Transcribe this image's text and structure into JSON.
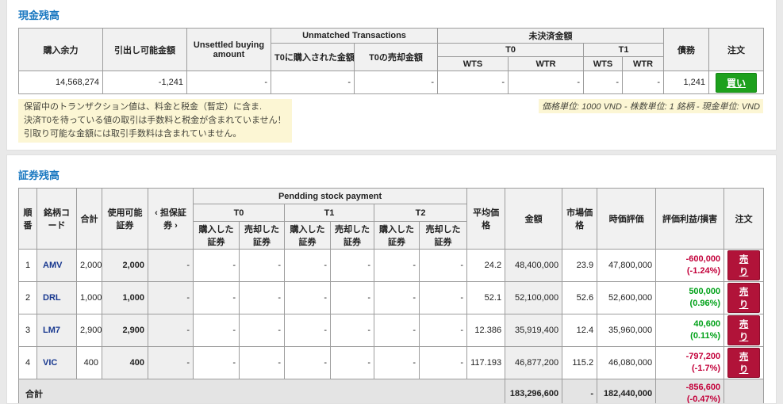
{
  "colors": {
    "title_blue": "#1877c0",
    "buy_green": "#1da01d",
    "sell_crimson": "#b11339",
    "gain_green": "#00a118",
    "loss_red": "#c3003a",
    "note_bg": "#fcf6d4"
  },
  "cash": {
    "title": "現金残高",
    "headers": {
      "buying_power": "購入余力",
      "withdrawable": "引出し可能金額",
      "unsettled_buying": "Unsettled buying amount",
      "unmatched": "Unmatched Transactions",
      "t0_bought": "T0に購入された金額",
      "t0_sold": "T0の売却金額",
      "pending_amount": "未決済金額",
      "t0": "T0",
      "t1": "T1",
      "t0_wts": "WTS",
      "t0_wtr": "WTR",
      "t1_wts": "WTS",
      "t1_wtr": "WTR",
      "debt": "債務",
      "order": "注文"
    },
    "row": {
      "buying_power": "14,568,274",
      "withdrawable": "-1,241",
      "unsettled_buying": "-",
      "t0_bought": "-",
      "t0_sold": "-",
      "t0_wts": "-",
      "t0_wtr": "-",
      "t1_wts": "-",
      "t1_wtr": "-",
      "debt": "1,241"
    },
    "buy_button": "買い",
    "notes": [
      "保留中のトランザクション値は、料金と税金（暫定）に含ま.",
      "決済T0を待っている値の取引は手数料と税金が含まれていません！",
      "引取り可能な金額には取引手数料は含まれていません。"
    ],
    "unit_note": "価格単位: 1000 VND - 株数単位: 1 銘柄 - 現金単位: VND"
  },
  "stock": {
    "title": "証券残高",
    "headers": {
      "index": "順番",
      "code": "銘柄コード",
      "total": "合計",
      "available": "使用可能証券",
      "collateral": "‹ 担保証券 ›",
      "pending": "Pendding stock payment",
      "t0": "T0",
      "t1": "T1",
      "t2": "T2",
      "t0_bought": "購入した証券",
      "t0_sold": "売却した証券",
      "t1_bought": "購入した証券",
      "t1_sold": "売却した証券",
      "t2_bought": "購入した証券",
      "t2_sold": "売却した証券",
      "avg_price": "平均価格",
      "amount": "金額",
      "market_price": "市場価格",
      "market_value": "時価評価",
      "profit_loss": "評価利益/損害",
      "order": "注文"
    },
    "sell_button": "売り",
    "rows": [
      {
        "index": "1",
        "code": "AMV",
        "total": "2,000",
        "available": "2,000",
        "collateral": "-",
        "t0b": "-",
        "t0s": "-",
        "t1b": "-",
        "t1s": "-",
        "t2b": "-",
        "t2s": "-",
        "avg": "24.2",
        "amount": "48,400,000",
        "market": "23.9",
        "value": "47,800,000",
        "profit": "-600,000",
        "pct": "(-1.24%)",
        "trend": "loss"
      },
      {
        "index": "2",
        "code": "DRL",
        "total": "1,000",
        "available": "1,000",
        "collateral": "-",
        "t0b": "-",
        "t0s": "-",
        "t1b": "-",
        "t1s": "-",
        "t2b": "-",
        "t2s": "-",
        "avg": "52.1",
        "amount": "52,100,000",
        "market": "52.6",
        "value": "52,600,000",
        "profit": "500,000",
        "pct": "(0.96%)",
        "trend": "gain"
      },
      {
        "index": "3",
        "code": "LM7",
        "total": "2,900",
        "available": "2,900",
        "collateral": "-",
        "t0b": "-",
        "t0s": "-",
        "t1b": "-",
        "t1s": "-",
        "t2b": "-",
        "t2s": "-",
        "avg": "12.386",
        "amount": "35,919,400",
        "market": "12.4",
        "value": "35,960,000",
        "profit": "40,600",
        "pct": "(0.11%)",
        "trend": "gain"
      },
      {
        "index": "4",
        "code": "VIC",
        "total": "400",
        "available": "400",
        "collateral": "-",
        "t0b": "-",
        "t0s": "-",
        "t1b": "-",
        "t1s": "-",
        "t2b": "-",
        "t2s": "-",
        "avg": "117.193",
        "amount": "46,877,200",
        "market": "115.2",
        "value": "46,080,000",
        "profit": "-797,200",
        "pct": "(-1.7%)",
        "trend": "loss"
      }
    ],
    "footer": {
      "label": "合計",
      "amount": "183,296,600",
      "market": "-",
      "value": "182,440,000",
      "profit": "-856,600",
      "pct": "(-0.47%)",
      "trend": "loss"
    }
  }
}
